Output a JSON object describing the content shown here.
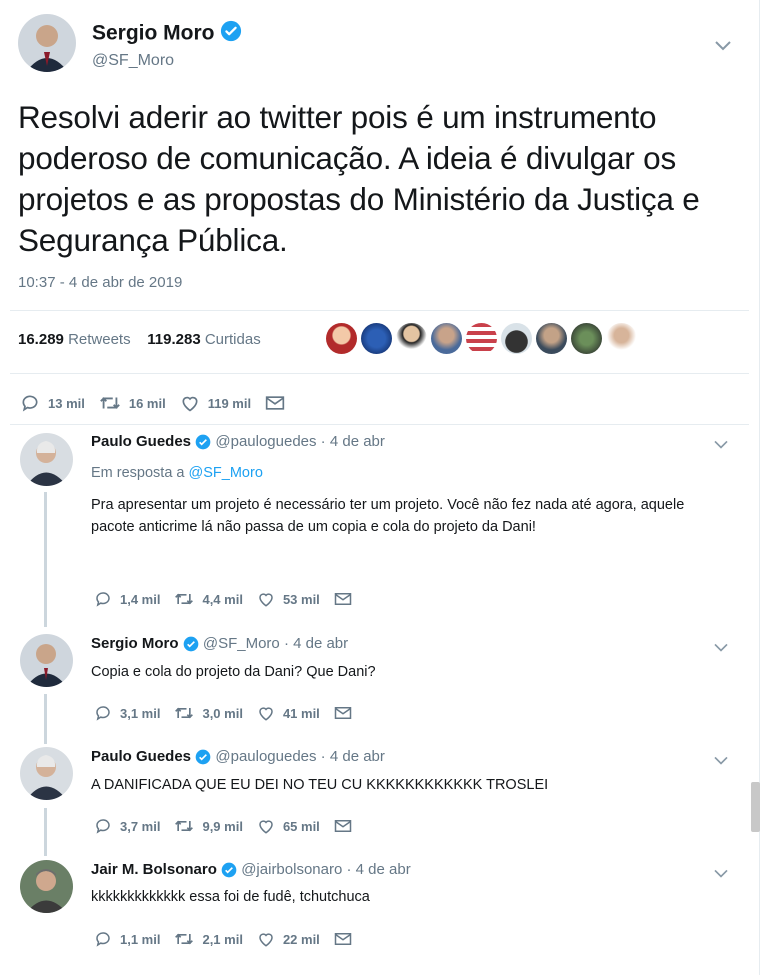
{
  "main_tweet": {
    "name": "Sergio Moro",
    "handle": "@SF_Moro",
    "text": "Resolvi aderir ao twitter pois é um instrumento poderoso de comunicação. A ideia é divulgar os projetos e as propostas do Ministério da Justiça e Segurança Pública.",
    "timestamp": "10:37 - 4 de abr de 2019",
    "retweets_count": "16.289",
    "retweets_label": "Retweets",
    "likes_count": "119.283",
    "likes_label": "Curtidas",
    "reply_count": "13 mil",
    "retweet_action_count": "16 mil",
    "like_action_count": "119 mil"
  },
  "replies": [
    {
      "name": "Paulo Guedes",
      "handle": "@pauloguedes · 4 de abr",
      "reply_to_prefix": "Em resposta a",
      "reply_to_handle": "@SF_Moro",
      "text": "Pra apresentar um projeto é necessário ter um projeto. Você não fez nada até agora, aquele pacote anticrime lá não passa de um copia e cola do projeto da Dani!",
      "replies": "1,4 mil",
      "retweets": "4,4 mil",
      "likes": "53 mil"
    },
    {
      "name": "Sergio Moro",
      "handle": "@SF_Moro · 4 de abr",
      "text": "Copia e cola do projeto da Dani? Que Dani?",
      "replies": "3,1 mil",
      "retweets": "3,0 mil",
      "likes": "41 mil"
    },
    {
      "name": "Paulo Guedes",
      "handle": "@pauloguedes · 4 de abr",
      "text": "A DANIFICADA QUE EU DEI NO TEU CU KKKKKKKKKKKK TROSLEI",
      "replies": "3,7 mil",
      "retweets": "9,9 mil",
      "likes": "65 mil"
    },
    {
      "name": "Jair M. Bolsonaro",
      "handle": "@jairbolsonaro · 4 de abr",
      "text": "kkkkkkkkkkkkk essa foi de fudê, tchutchuca",
      "replies": "1,1 mil",
      "retweets": "2,1 mil",
      "likes": "22 mil"
    }
  ],
  "colors": {
    "accent": "#1da1f2",
    "text_secondary": "#657786",
    "divider": "#e6ecf0"
  },
  "icons": {
    "verified": "verified-badge-icon",
    "reply": "reply-icon",
    "retweet": "retweet-icon",
    "like": "heart-icon",
    "dm": "envelope-icon",
    "caret": "chevron-down-icon"
  }
}
